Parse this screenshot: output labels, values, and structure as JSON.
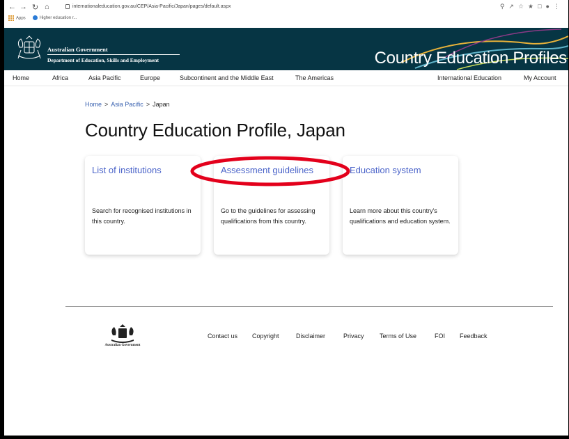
{
  "browser": {
    "url": "internationaleducation.gov.au/CEP/Asia-Pacific/Japan/pages/default.aspx",
    "bookmarks": [
      "Apps",
      "Higher education r..."
    ]
  },
  "banner": {
    "gov_name": "Australian Government",
    "dept_name": "Department of Education, Skills and Employment",
    "site_title": "Country Education Profiles",
    "background": "#063544"
  },
  "nav": {
    "items": [
      "Home",
      "Africa",
      "Asia Pacific",
      "Europe",
      "Subcontinent and the Middle East",
      "The Americas"
    ],
    "right_items": [
      "International Education",
      "My Account"
    ]
  },
  "breadcrumb": {
    "home": "Home",
    "sep": ">",
    "region": "Asia Pacific",
    "current": "Japan"
  },
  "page": {
    "title": "Country Education Profile, Japan"
  },
  "cards": [
    {
      "title": "List of institutions",
      "desc": "Search for recognised institutions in this country."
    },
    {
      "title": "Assessment guidelines",
      "desc": "Go to the guidelines for assessing qualifications from this country."
    },
    {
      "title": "Education system",
      "desc": "Learn more about this country's qualifications and education system."
    }
  ],
  "highlight_color": "#e3001b",
  "footer": {
    "logo_text": "Australian Government",
    "links": [
      "Contact us",
      "Copyright",
      "Disclaimer",
      "Privacy",
      "Terms of Use",
      "FOI",
      "Feedback"
    ]
  }
}
